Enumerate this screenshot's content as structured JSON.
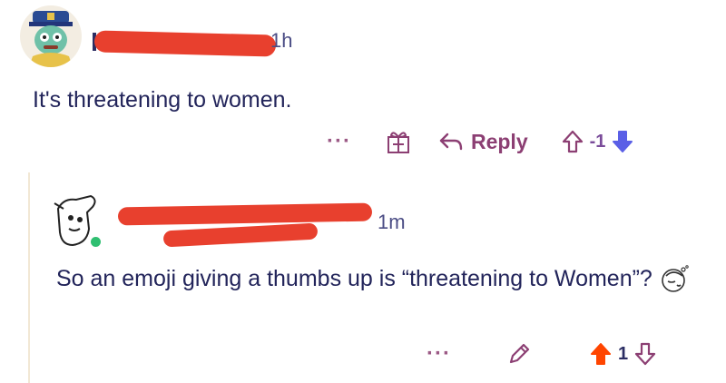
{
  "comment1": {
    "time": "1h",
    "body": "It's threatening to women.",
    "actions": {
      "more": "···",
      "reply_label": "Reply",
      "score": "-1"
    },
    "avatar": "avatar-cartoon-icon",
    "gift_icon": "gift-icon",
    "reply_icon": "reply-arrow-icon",
    "upvote_icon": "upvote-outline-icon",
    "downvote_icon": "downvote-filled-icon",
    "vote_colors": {
      "downvote": "#5a5fe6",
      "upvote": "#ff4500"
    }
  },
  "comment2": {
    "time": "1m",
    "body": "So an emoji giving a thumbs up is “threatening to Women”?",
    "emoji": "facepalm-emoji",
    "actions": {
      "more": "···",
      "score": "1"
    },
    "avatar": "avatar-thumbs-icon",
    "online": true,
    "edit_icon": "pencil-icon",
    "upvote_icon": "upvote-filled-icon",
    "downvote_icon": "downvote-outline-icon"
  }
}
